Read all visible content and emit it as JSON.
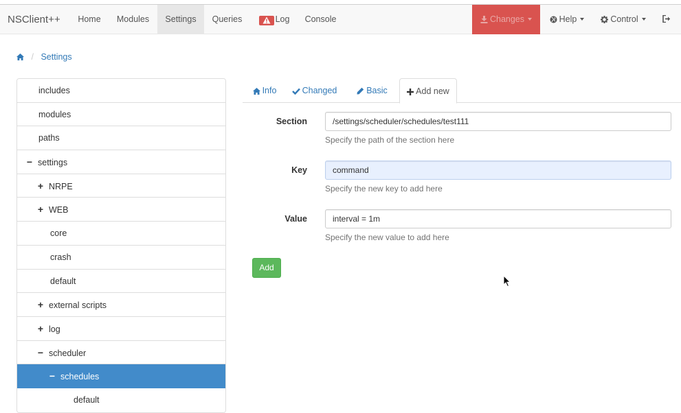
{
  "navbar": {
    "brand": "NSClient++",
    "items": [
      {
        "label": "Home"
      },
      {
        "label": "Modules"
      },
      {
        "label": "Settings"
      },
      {
        "label": "Queries"
      },
      {
        "label": "Log"
      },
      {
        "label": "Console"
      }
    ],
    "right": {
      "changes": "Changes",
      "help": "Help",
      "control": "Control"
    },
    "colors": {
      "changes_bg": "#d9534f",
      "active_bg": "#e7e7e7"
    }
  },
  "breadcrumb": {
    "current": "Settings"
  },
  "tree": {
    "items": [
      {
        "label": "includes"
      },
      {
        "label": "modules"
      },
      {
        "label": "paths"
      },
      {
        "label": "settings",
        "toggle": "−"
      },
      {
        "label": "NRPE",
        "toggle": "+"
      },
      {
        "label": "WEB",
        "toggle": "+"
      },
      {
        "label": "core"
      },
      {
        "label": "crash"
      },
      {
        "label": "default"
      },
      {
        "label": "external scripts",
        "toggle": "+"
      },
      {
        "label": "log",
        "toggle": "+"
      },
      {
        "label": "scheduler",
        "toggle": "−"
      },
      {
        "label": "schedules",
        "toggle": "−",
        "selected": true
      },
      {
        "label": "default"
      }
    ],
    "selected_color": "#428bca"
  },
  "tabs": [
    {
      "label": "Info",
      "icon": "home-icon"
    },
    {
      "label": "Changed",
      "icon": "check-icon"
    },
    {
      "label": "Basic",
      "icon": "pencil-icon"
    },
    {
      "label": "Add new",
      "icon": "plus-icon",
      "active": true
    }
  ],
  "form": {
    "section": {
      "label": "Section",
      "value": "/settings/scheduler/schedules/test111",
      "help": "Specify the path of the section here"
    },
    "key": {
      "label": "Key",
      "value": "command",
      "help": "Specify the new key to add here"
    },
    "value": {
      "label": "Value",
      "value": "interval = 1m",
      "help": "Specify the new value to add here"
    },
    "add_button": "Add"
  }
}
